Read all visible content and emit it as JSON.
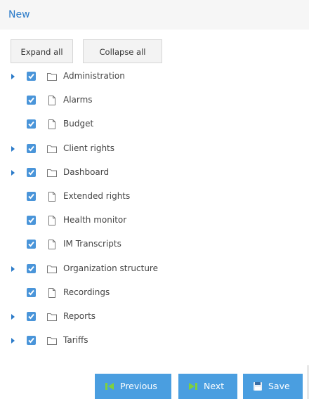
{
  "header": {
    "title": "New"
  },
  "toolbar": {
    "expand_label": "Expand all",
    "collapse_label": "Collapse all"
  },
  "tree": [
    {
      "label": "Administration",
      "type": "folder",
      "expandable": true,
      "checked": true
    },
    {
      "label": "Alarms",
      "type": "page",
      "expandable": false,
      "checked": true
    },
    {
      "label": "Budget",
      "type": "page",
      "expandable": false,
      "checked": true
    },
    {
      "label": "Client rights",
      "type": "folder",
      "expandable": true,
      "checked": true
    },
    {
      "label": "Dashboard",
      "type": "folder",
      "expandable": true,
      "checked": true
    },
    {
      "label": "Extended rights",
      "type": "page",
      "expandable": false,
      "checked": true
    },
    {
      "label": "Health monitor",
      "type": "page",
      "expandable": false,
      "checked": true
    },
    {
      "label": "IM Transcripts",
      "type": "page",
      "expandable": false,
      "checked": true
    },
    {
      "label": "Organization structure",
      "type": "folder",
      "expandable": true,
      "checked": true
    },
    {
      "label": "Recordings",
      "type": "page",
      "expandable": false,
      "checked": true
    },
    {
      "label": "Reports",
      "type": "folder",
      "expandable": true,
      "checked": true
    },
    {
      "label": "Tariffs",
      "type": "folder",
      "expandable": true,
      "checked": true
    }
  ],
  "footer": {
    "previous_label": "Previous",
    "next_label": "Next",
    "save_label": "Save"
  },
  "colors": {
    "accent": "#2b7bc9",
    "checkbox": "#4a95d9",
    "button": "#4a9ee0"
  }
}
